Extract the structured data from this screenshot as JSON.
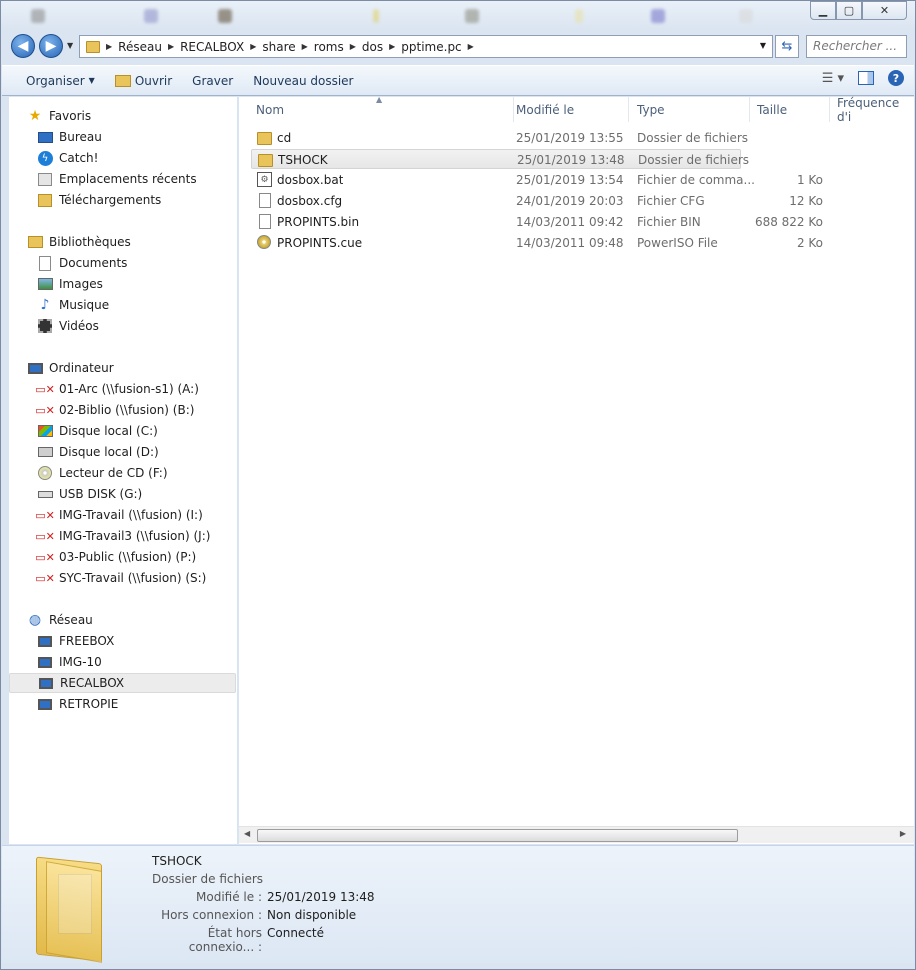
{
  "nav": {
    "back_icon": "back-arrow-icon",
    "forward_icon": "forward-arrow-icon",
    "breadcrumb": [
      "Réseau",
      "RECALBOX",
      "share",
      "roms",
      "dos",
      "pptime.pc"
    ],
    "search_placeholder": "Rechercher ..."
  },
  "toolbar": {
    "organize": "Organiser",
    "open": "Ouvrir",
    "burn": "Graver",
    "new_folder": "Nouveau dossier"
  },
  "sidebar": {
    "favorites": {
      "label": "Favoris",
      "items": [
        "Bureau",
        "Catch!",
        "Emplacements récents",
        "Téléchargements"
      ]
    },
    "libraries": {
      "label": "Bibliothèques",
      "items": [
        "Documents",
        "Images",
        "Musique",
        "Vidéos"
      ]
    },
    "computer": {
      "label": "Ordinateur",
      "items": [
        "01-Arc (\\\\fusion-s1) (A:)",
        "02-Biblio (\\\\fusion) (B:)",
        "Disque local (C:)",
        "Disque local (D:)",
        "Lecteur de CD (F:)",
        "USB DISK (G:)",
        "IMG-Travail (\\\\fusion) (I:)",
        "IMG-Travail3 (\\\\fusion) (J:)",
        "03-Public (\\\\fusion) (P:)",
        "SYC-Travail (\\\\fusion) (S:)"
      ]
    },
    "network": {
      "label": "Réseau",
      "items": [
        "FREEBOX",
        "IMG-10",
        "RECALBOX",
        "RETROPIE"
      ],
      "selected": "RECALBOX"
    }
  },
  "columns": {
    "name": "Nom",
    "modified": "Modifié le",
    "type": "Type",
    "size": "Taille",
    "frequency": "Fréquence d'i"
  },
  "files": [
    {
      "name": "cd",
      "modified": "25/01/2019 13:55",
      "type": "Dossier de fichiers",
      "size": "",
      "icon": "folder-icon"
    },
    {
      "name": "TSHOCK",
      "modified": "25/01/2019 13:48",
      "type": "Dossier de fichiers",
      "size": "",
      "icon": "folder-icon"
    },
    {
      "name": "dosbox.bat",
      "modified": "25/01/2019 13:54",
      "type": "Fichier de comma...",
      "size": "1 Ko",
      "icon": "batch-file-icon"
    },
    {
      "name": "dosbox.cfg",
      "modified": "24/01/2019 20:03",
      "type": "Fichier CFG",
      "size": "12 Ko",
      "icon": "file-icon"
    },
    {
      "name": "PROPINTS.bin",
      "modified": "14/03/2011 09:42",
      "type": "Fichier BIN",
      "size": "688 822 Ko",
      "icon": "file-icon"
    },
    {
      "name": "PROPINTS.cue",
      "modified": "14/03/2011 09:48",
      "type": "PowerISO File",
      "size": "2 Ko",
      "icon": "disc-image-icon"
    }
  ],
  "selected_file": "TSHOCK",
  "details": {
    "name": "TSHOCK",
    "type": "Dossier de fichiers",
    "modified_label": "Modifié le :",
    "modified_value": "25/01/2019 13:48",
    "offline_label": "Hors connexion :",
    "offline_value": "Non disponible",
    "offline_state_label": "État hors connexio... :",
    "offline_state_value": "Connecté"
  },
  "colors": {
    "accent": "#2a64b5",
    "folder": "#e8c45a",
    "selection": "#e8e8e8"
  }
}
